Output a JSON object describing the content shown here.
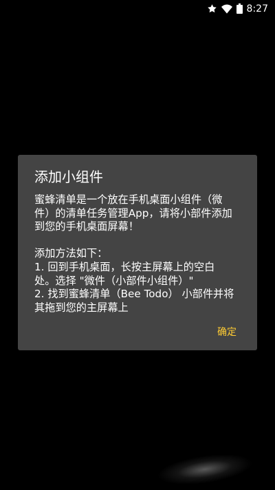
{
  "status_bar": {
    "time": "8:27",
    "icons": [
      "star-icon",
      "wifi-icon",
      "battery-icon"
    ]
  },
  "dialog": {
    "title": "添加小组件",
    "body_lines": [
      "蜜蜂清单是一个放在手机桌面小组件（微",
      "件）的清单任务管理App，请将小部件添加",
      "到您的手机桌面屏幕！",
      "",
      "添加方法如下：",
      "1. 回到手机桌面，长按主屏幕上的空白",
      "处。选择 \"微件（小部件小组件）\"",
      "2. 找到蜜蜂清单（Bee Todo） 小部件并将",
      "其拖到您的主屏幕上"
    ],
    "confirm_label": "确定"
  },
  "colors": {
    "background": "#000000",
    "dialog_background": "#444444",
    "accent": "#ffcc33",
    "text": "#ffffff"
  }
}
